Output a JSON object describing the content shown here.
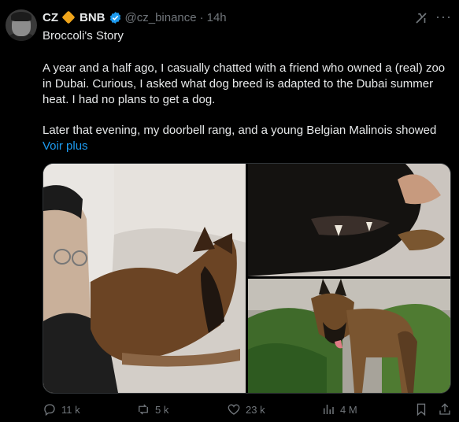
{
  "author": {
    "name": "CZ",
    "affiliation": "BNB",
    "handle": "@cz_binance",
    "separator": "·",
    "time": "14h"
  },
  "tweet": {
    "title": "Broccoli's Story",
    "paragraph1": "A year and a half ago, I casually chatted with a friend who owned a (real) zoo in Dubai. Curious, I asked what dog breed is adapted to the Dubai summer heat. I had no plans to get a dog.",
    "paragraph2": "Later that evening, my doorbell rang, and a young Belgian Malinois showed",
    "show_more": "Voir plus"
  },
  "actions": {
    "replies": "11 k",
    "reposts": "5 k",
    "likes": "23 k",
    "views": "4 M"
  },
  "colors": {
    "background": "#000000",
    "text": "#e7e9ea",
    "muted": "#71767b",
    "link": "#1d9bf0",
    "bnb": "#f0a51b"
  },
  "icons": [
    "grok-icon",
    "more-icon",
    "verified-badge-icon",
    "reply-icon",
    "repost-icon",
    "like-icon",
    "views-icon",
    "bookmark-icon",
    "share-icon"
  ]
}
